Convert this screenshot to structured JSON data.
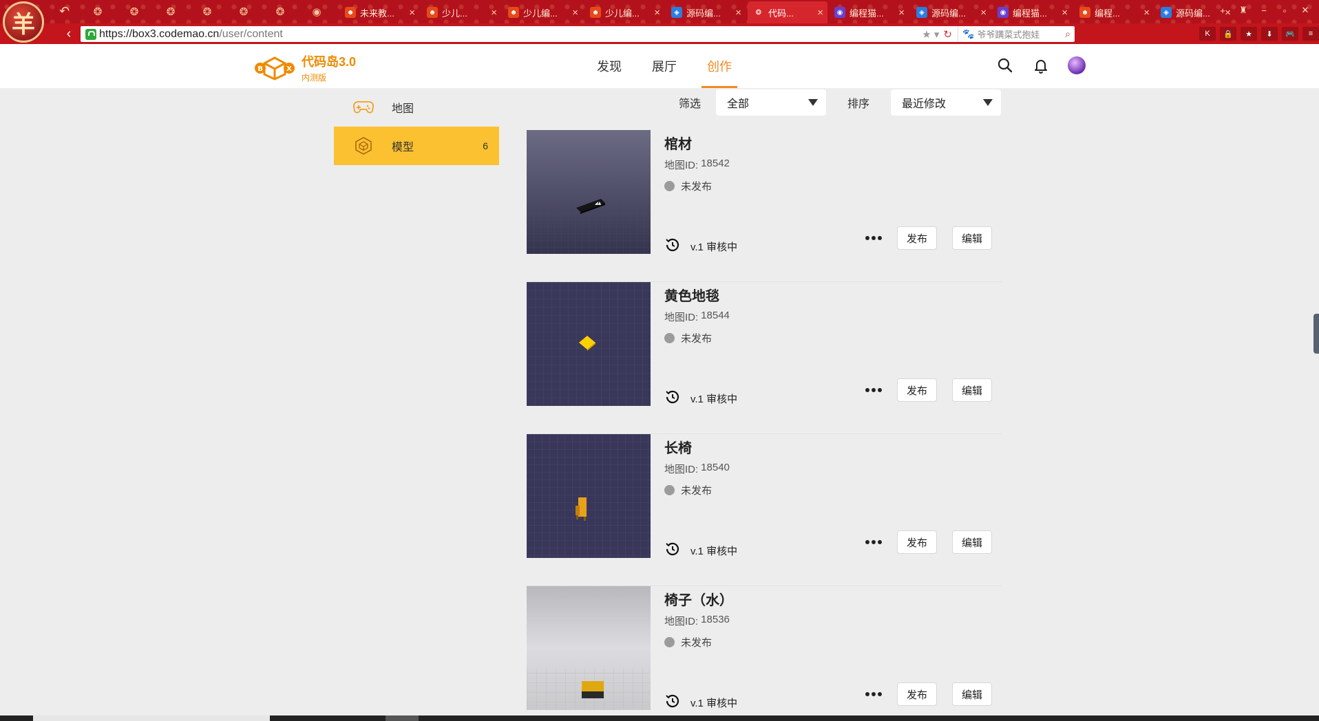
{
  "browser": {
    "tabs": [
      {
        "title": "未来教...",
        "icon": "codemao-icon",
        "active": false
      },
      {
        "title": "少儿...",
        "icon": "codemao-icon",
        "active": false
      },
      {
        "title": "少儿编...",
        "icon": "codemao-icon",
        "active": false
      },
      {
        "title": "少儿编...",
        "icon": "codemao-icon",
        "active": false
      },
      {
        "title": "源码编...",
        "icon": "source-icon",
        "active": false
      },
      {
        "title": "代码...",
        "icon": "box3-icon",
        "active": true
      },
      {
        "title": "编程猫...",
        "icon": "codecat-icon",
        "active": false
      },
      {
        "title": "源码编...",
        "icon": "source-icon",
        "active": false
      },
      {
        "title": "编程猫...",
        "icon": "codecat-icon",
        "active": false
      },
      {
        "title": "编程...",
        "icon": "codemao-icon",
        "active": false
      },
      {
        "title": "源码编...",
        "icon": "source-icon",
        "active": false
      }
    ],
    "url_host": "https://box3.codemao.cn",
    "url_path": "/user/content",
    "search_placeholder": "爷爷蹒菜式抱娃",
    "close_glyph": "×",
    "badge_glyph": "羊"
  },
  "header": {
    "brand_title": "代码岛3.0",
    "brand_subtitle": "内测版",
    "nav": [
      {
        "label": "发现",
        "active": false
      },
      {
        "label": "展厅",
        "active": false
      },
      {
        "label": "创作",
        "active": true
      }
    ],
    "accent_color": "#f5891f"
  },
  "sidebar": {
    "items": [
      {
        "label": "地图",
        "icon": "gamepad-icon",
        "count": "",
        "active": false
      },
      {
        "label": "模型",
        "icon": "cube-icon",
        "count": "6",
        "active": true
      }
    ],
    "active_color": "#fcc130"
  },
  "filters": {
    "filter_label": "筛选",
    "filter_value": "全部",
    "sort_label": "排序",
    "sort_value": "最近修改"
  },
  "items": [
    {
      "title": "棺材",
      "id_label": "地图ID:",
      "id_value": "18542",
      "status": "未发布",
      "version": "v.1 审核中",
      "publish_label": "发布",
      "edit_label": "编辑",
      "thumb": "grid-coffin"
    },
    {
      "title": "黄色地毯",
      "id_label": "地图ID:",
      "id_value": "18544",
      "status": "未发布",
      "version": "v.1 审核中",
      "publish_label": "发布",
      "edit_label": "编辑",
      "thumb": "grid-carpet"
    },
    {
      "title": "长椅",
      "id_label": "地图ID:",
      "id_value": "18540",
      "status": "未发布",
      "version": "v.1 审核中",
      "publish_label": "发布",
      "edit_label": "编辑",
      "thumb": "grid-bench"
    },
    {
      "title": "椅子（水）",
      "id_label": "地图ID:",
      "id_value": "18536",
      "status": "未发布",
      "version": "v.1 审核中",
      "publish_label": "发布",
      "edit_label": "编辑",
      "thumb": "light-chair"
    }
  ]
}
